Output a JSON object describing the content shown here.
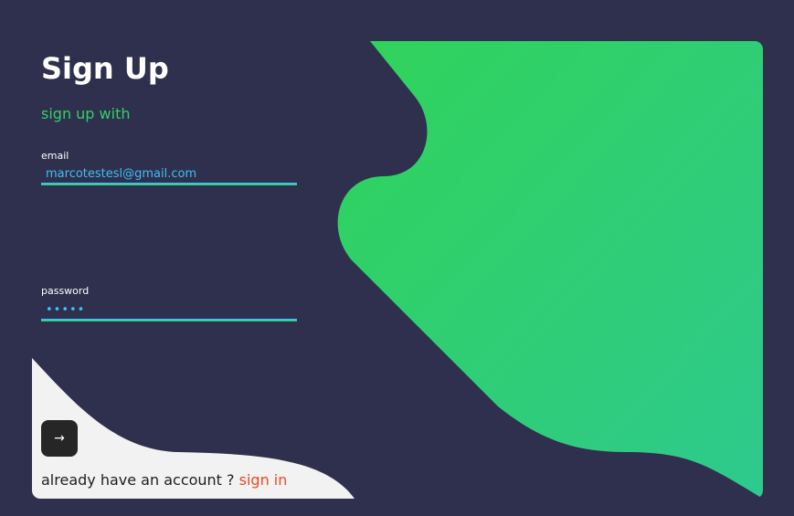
{
  "form": {
    "title": "Sign Up",
    "subtitle": "sign up with",
    "email_label": "email",
    "email_value": "marcotestesl@gmail.com",
    "password_label": "password",
    "password_value": "12345",
    "submit_glyph": "→",
    "submit_icon": "arrow-right-icon",
    "signin_prompt": "already have an account ?",
    "signin_link": "sign in"
  },
  "colors": {
    "background": "#2e304e",
    "accent_green": "#31d264",
    "gradient_end": "#2ec98c",
    "input_blue": "#3fbff0",
    "link_orange": "#e84a1f",
    "light_panel": "#f2f2f2",
    "button_dark": "#262626"
  }
}
